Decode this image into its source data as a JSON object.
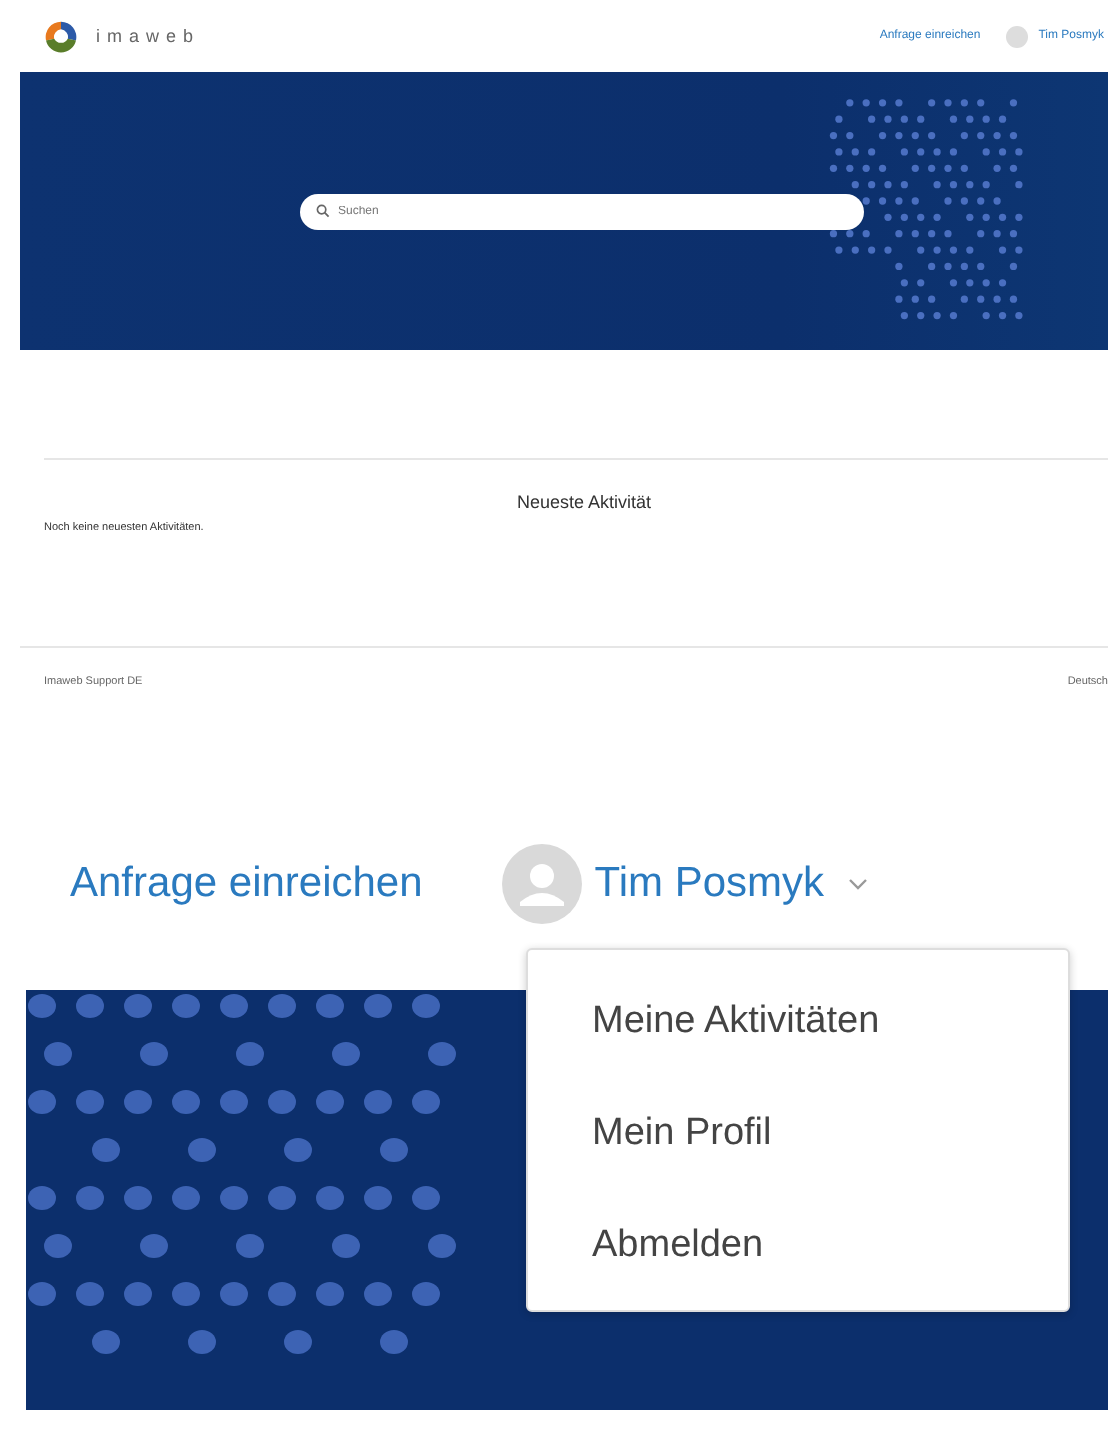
{
  "header": {
    "logo_text": "imaweb",
    "submit_link": "Anfrage einreichen",
    "user_name": "Tim Posmyk"
  },
  "hero": {
    "search": {
      "placeholder": "Suchen"
    }
  },
  "activity": {
    "title": "Neueste Aktivität",
    "empty_text": "Noch keine neuesten Aktivitäten."
  },
  "footer": {
    "site_name": "Imaweb Support DE",
    "language": "Deutsch"
  },
  "zoomed_header": {
    "submit_link": "Anfrage einreichen",
    "user_name": "Tim Posmyk",
    "user_menu": {
      "expanded": true,
      "items": [
        {
          "label": "Meine Aktivitäten"
        },
        {
          "label": "Mein Profil"
        },
        {
          "label": "Abmelden"
        }
      ]
    }
  }
}
